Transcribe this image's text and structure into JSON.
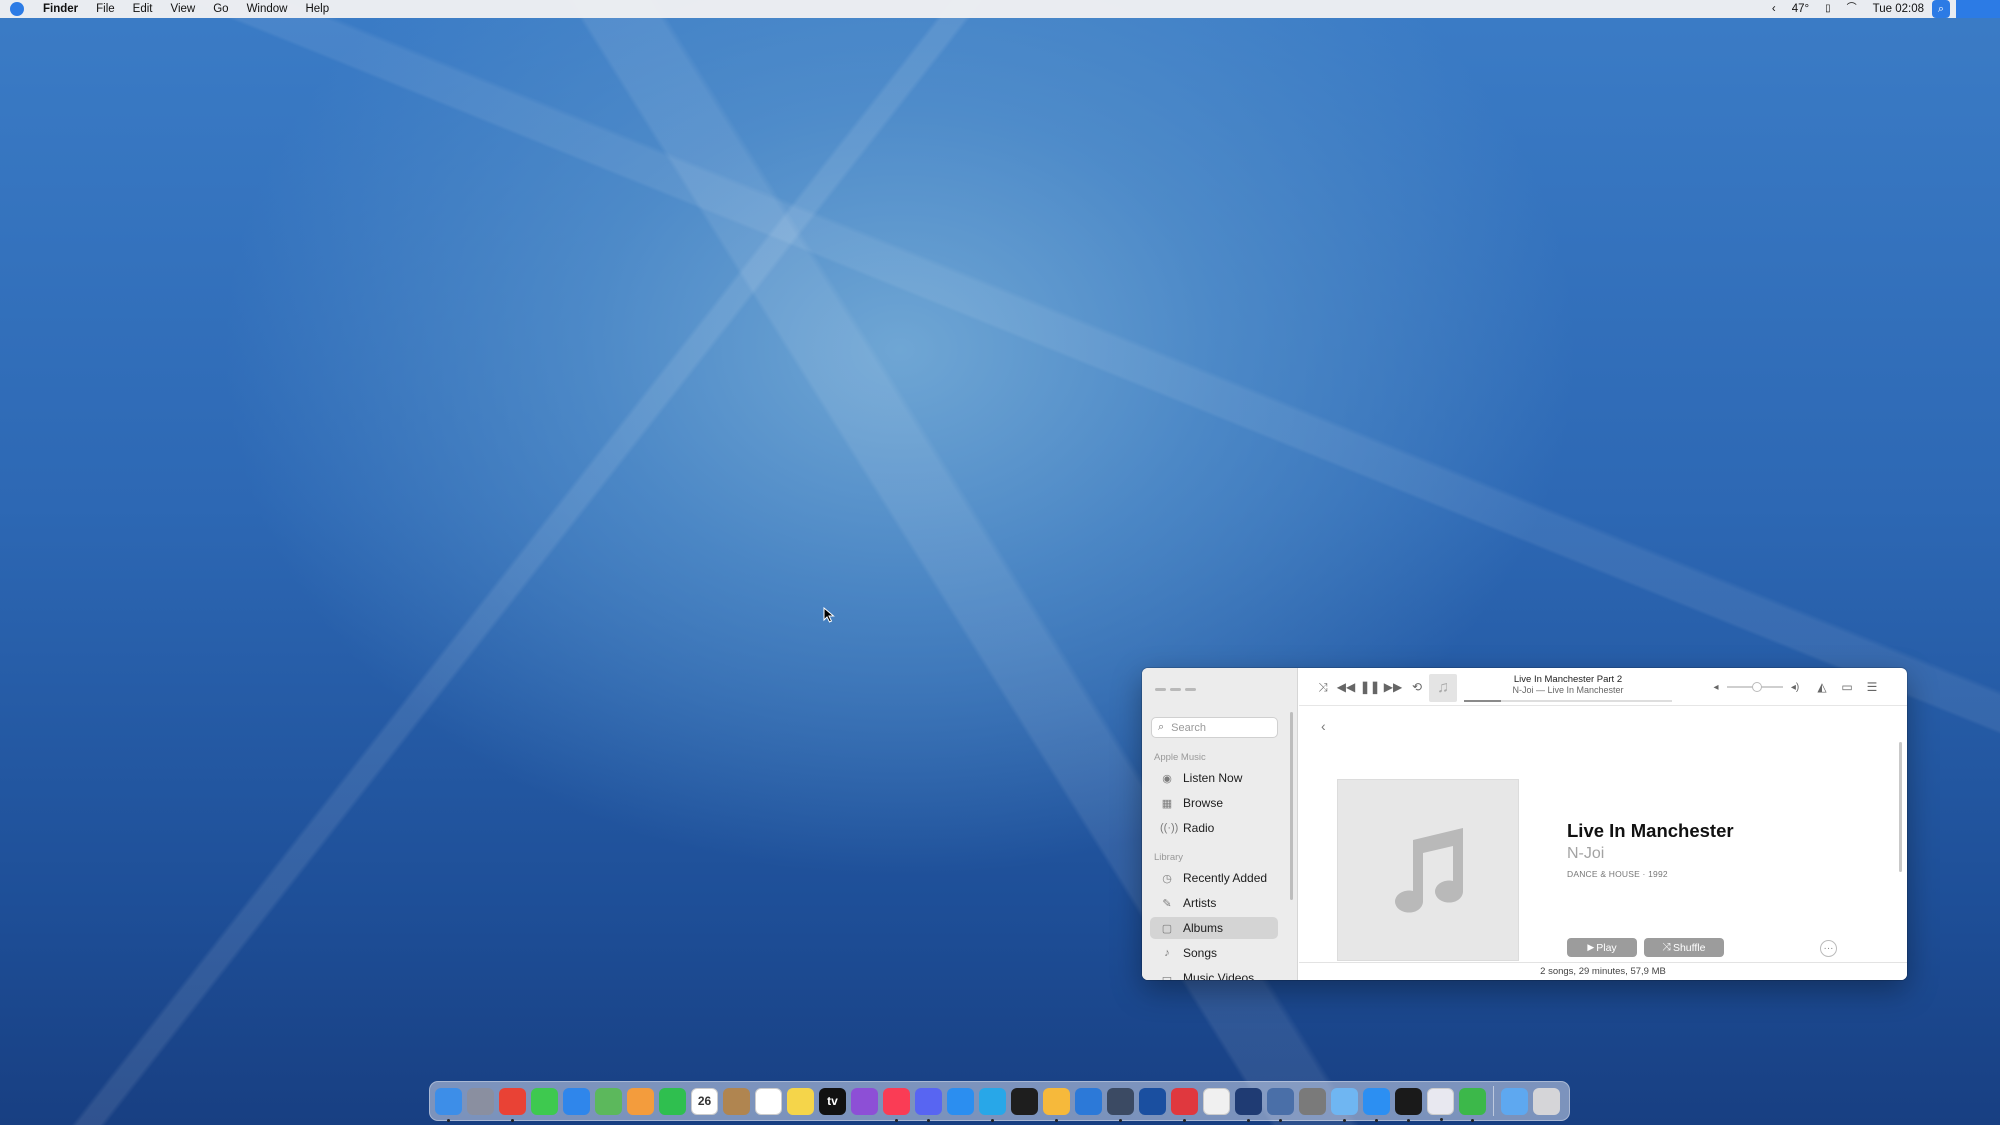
{
  "menubar": {
    "app_name": "Finder",
    "items": [
      "File",
      "Edit",
      "View",
      "Go",
      "Window",
      "Help"
    ],
    "status": {
      "chevron": "‹",
      "weather": "47°",
      "clock": "Tue 02:08"
    }
  },
  "music": {
    "player": {
      "track_title": "Live In Manchester Part 2",
      "track_subtitle": "N-Joi — Live In Manchester",
      "progress": 0.18,
      "volume": 0.45
    },
    "sidebar": {
      "search_placeholder": "Search",
      "section_apple_music": "Apple Music",
      "section_library": "Library",
      "items": [
        {
          "label": "Listen Now",
          "icon": "play-circle-icon"
        },
        {
          "label": "Browse",
          "icon": "grid-icon"
        },
        {
          "label": "Radio",
          "icon": "radio-waves-icon"
        },
        {
          "label": "Recently Added",
          "icon": "clock-icon"
        },
        {
          "label": "Artists",
          "icon": "microphone-icon"
        },
        {
          "label": "Albums",
          "icon": "album-icon"
        },
        {
          "label": "Songs",
          "icon": "note-icon"
        },
        {
          "label": "Music Videos",
          "icon": "video-icon"
        }
      ],
      "selected": "Albums"
    },
    "album": {
      "title": "Live In Manchester",
      "artist": "N-Joi",
      "meta": "DANCE & HOUSE · 1992",
      "play_label": "Play",
      "shuffle_label": "Shuffle",
      "status": "2 songs, 29 minutes, 57,9 MB"
    }
  },
  "dock": {
    "apps": [
      {
        "name": "finder",
        "color": "#3d8ee8",
        "running": true
      },
      {
        "name": "launchpad",
        "color": "#8a8fa0",
        "running": false
      },
      {
        "name": "chrome",
        "color": "#e94235",
        "running": true
      },
      {
        "name": "messages",
        "color": "#3ec94f",
        "running": false
      },
      {
        "name": "mail",
        "color": "#2f86eb",
        "running": false
      },
      {
        "name": "maps",
        "color": "#5cb85c",
        "running": false
      },
      {
        "name": "photos",
        "color": "#f39c3d",
        "running": false
      },
      {
        "name": "facetime",
        "color": "#2fbf4f",
        "running": false
      },
      {
        "name": "calendar",
        "color": "#ffffff",
        "running": false,
        "text": "26"
      },
      {
        "name": "contacts",
        "color": "#b08550",
        "running": false
      },
      {
        "name": "reminders",
        "color": "#ffffff",
        "running": false
      },
      {
        "name": "notes",
        "color": "#f5d54a",
        "running": false
      },
      {
        "name": "apple-tv",
        "color": "#111111",
        "running": false,
        "text": "tv"
      },
      {
        "name": "podcasts",
        "color": "#8d4fd6",
        "running": false
      },
      {
        "name": "music",
        "color": "#fa3c55",
        "running": true
      },
      {
        "name": "discord",
        "color": "#5865f2",
        "running": true
      },
      {
        "name": "app-store",
        "color": "#2b8ef0",
        "running": false
      },
      {
        "name": "proxyman",
        "color": "#28a7e8",
        "running": true
      },
      {
        "name": "figma",
        "color": "#1e1e1e",
        "running": false
      },
      {
        "name": "sketch",
        "color": "#f6b93b",
        "running": true
      },
      {
        "name": "xcode-tools",
        "color": "#2c79d8",
        "running": false
      },
      {
        "name": "instruments",
        "color": "#3b4a63",
        "running": true
      },
      {
        "name": "quicktime",
        "color": "#1a4fa0",
        "running": false
      },
      {
        "name": "magnet",
        "color": "#e0383e",
        "running": true
      },
      {
        "name": "pixelmator",
        "color": "#f0f0f0",
        "running": false
      },
      {
        "name": "xcode",
        "color": "#1f3b73",
        "running": true
      },
      {
        "name": "preview",
        "color": "#4a6fa8",
        "running": true
      },
      {
        "name": "system-preferences",
        "color": "#7a7a7a",
        "running": false
      },
      {
        "name": "finder-window",
        "color": "#6fb6f2",
        "running": true
      },
      {
        "name": "safari",
        "color": "#2c8ff2",
        "running": true
      },
      {
        "name": "terminal",
        "color": "#1a1a1a",
        "running": true
      },
      {
        "name": "script-editor",
        "color": "#e8e8f0",
        "running": true
      },
      {
        "name": "numbers",
        "color": "#3cb84a",
        "running": true
      }
    ],
    "trailing": [
      {
        "name": "downloads-folder",
        "color": "#5ea8f0"
      },
      {
        "name": "trash",
        "color": "#d5d5d8"
      }
    ]
  }
}
